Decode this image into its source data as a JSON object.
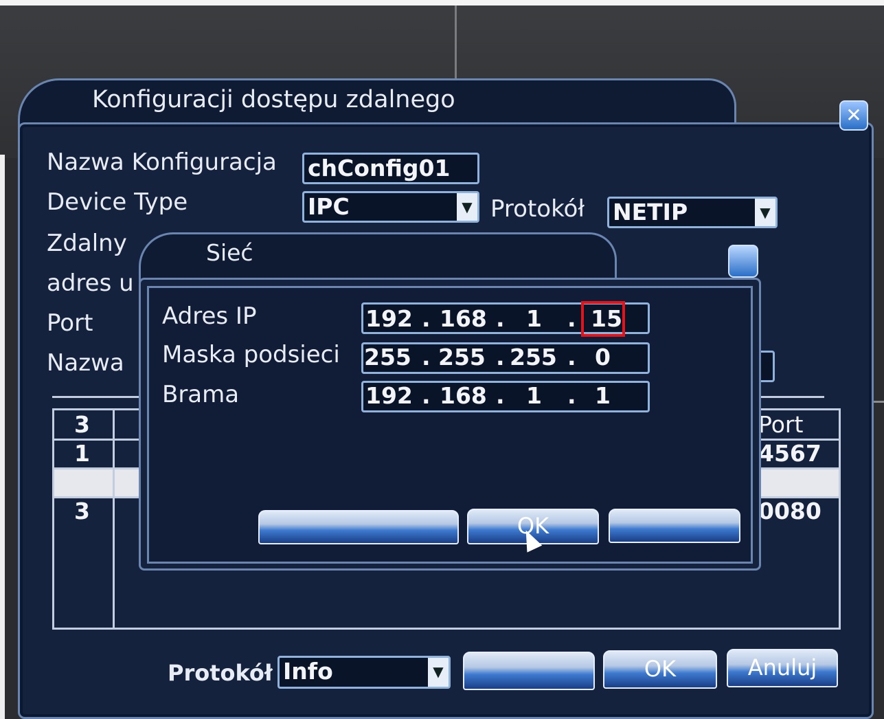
{
  "main_window": {
    "title": "Konfiguracji dostępu zdalnego",
    "labels": {
      "config_name": "Nazwa Konfiguracja",
      "device_type": "Device Type",
      "remote": "Zdalny",
      "address": "adres u",
      "port": "Port",
      "name": "Nazwa"
    },
    "config_name_value": "chConfig01",
    "device_type_value": "IPC",
    "protocol_label": "Protokół",
    "protocol_value": "NETIP",
    "table": {
      "header_count": "3",
      "header_port": "Port",
      "rows": [
        {
          "index": "1",
          "port": "4567"
        },
        {
          "index": "",
          "port": ""
        },
        {
          "index": "3",
          "port": "0080"
        }
      ]
    },
    "bottom": {
      "protocol_label": "Protokół",
      "protocol_value": "Info",
      "button_1": "",
      "button_ok": "OK",
      "button_cancel": "Anuluj"
    }
  },
  "network_dialog": {
    "title": "Sieć",
    "ip_label": "Adres IP",
    "mask_label": "Maska podsieci",
    "gateway_label": "Brama",
    "ip": [
      "192",
      "168",
      "1",
      "15"
    ],
    "mask": [
      "255",
      "255",
      "255",
      "0"
    ],
    "gateway": [
      "192",
      "168",
      "1",
      "1"
    ],
    "buttons": {
      "ok": "OK"
    }
  },
  "colors": {
    "highlight": "#e0141b",
    "window_bg": "#14223d",
    "border": "#6a86b0"
  }
}
